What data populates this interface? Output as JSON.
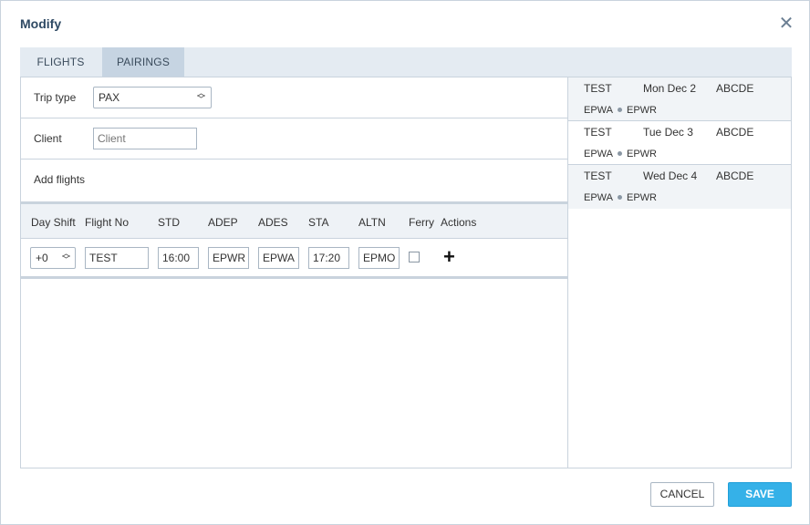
{
  "dialog": {
    "title": "Modify"
  },
  "tabs": [
    {
      "label": "FLIGHTS"
    },
    {
      "label": "PAIRINGS"
    }
  ],
  "form": {
    "trip_type_label": "Trip type",
    "trip_type_value": "PAX",
    "client_label": "Client",
    "client_placeholder": "Client",
    "add_flights_label": "Add flights"
  },
  "flights_table": {
    "headers": [
      "Day Shift",
      "Flight No",
      "STD",
      "ADEP",
      "ADES",
      "STA",
      "ALTN",
      "Ferry",
      "Actions"
    ],
    "row": {
      "day_shift": "+0",
      "flight_no": "TEST",
      "std": "16:00",
      "adep": "EPWR",
      "ades": "EPWA",
      "sta": "17:20",
      "altn": "EPMO",
      "ferry": false
    }
  },
  "pairings": [
    {
      "flight": "TEST",
      "date": "Mon Dec 2",
      "code": "ABCDE",
      "from": "EPWA",
      "to": "EPWR"
    },
    {
      "flight": "TEST",
      "date": "Tue Dec 3",
      "code": "ABCDE",
      "from": "EPWA",
      "to": "EPWR"
    },
    {
      "flight": "TEST",
      "date": "Wed Dec 4",
      "code": "ABCDE",
      "from": "EPWA",
      "to": "EPWR"
    }
  ],
  "buttons": {
    "cancel": "CANCEL",
    "save": "SAVE"
  },
  "icons": {
    "close": "close-icon",
    "add": "plus-icon",
    "select": "chevron-updown-icon"
  },
  "colors": {
    "save_bg": "#35b1e8",
    "active_tab": "#c6d4e2",
    "title": "#2f4a64"
  }
}
